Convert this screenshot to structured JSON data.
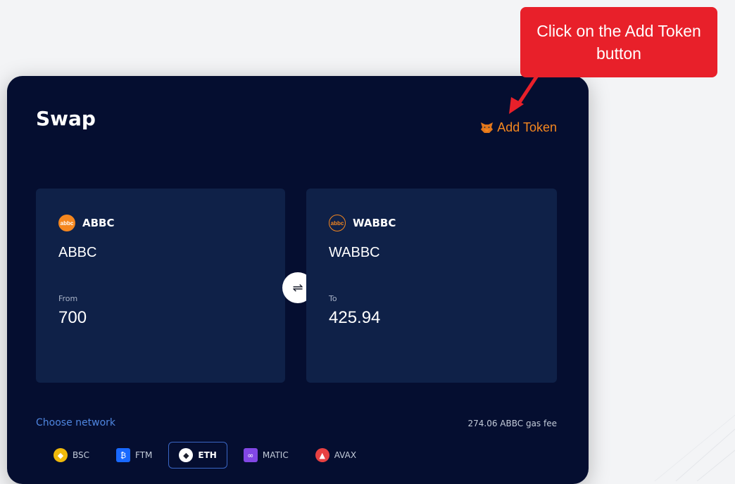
{
  "callout": {
    "text": "Click on the Add Token button"
  },
  "swap": {
    "title": "Swap",
    "add_token_label": "Add Token",
    "from": {
      "symbol": "ABBC",
      "name": "ABBC",
      "label": "From",
      "amount": "700",
      "logo_text": "abbc"
    },
    "to": {
      "symbol": "WABBC",
      "name": "WABBC",
      "label": "To",
      "amount": "425.94",
      "logo_text": "abbc"
    },
    "swap_icon": "⇌",
    "choose_network_label": "Choose network",
    "gas_fee": "274.06 ABBC gas fee",
    "networks": [
      {
        "label": "BSC",
        "icon": "bsc-icon",
        "glyph": "◆"
      },
      {
        "label": "FTM",
        "icon": "ftm-icon",
        "glyph": "₿"
      },
      {
        "label": "ETH",
        "icon": "eth-icon",
        "glyph": "◆"
      },
      {
        "label": "MATIC",
        "icon": "matic-icon",
        "glyph": "∞"
      },
      {
        "label": "AVAX",
        "icon": "avax-icon",
        "glyph": "▲"
      }
    ],
    "selected_network": "ETH"
  },
  "colors": {
    "card_bg": "#050e30",
    "panel_bg": "#0f2148",
    "accent_orange": "#f5871f",
    "link_blue": "#4f86e0",
    "callout_red": "#e8202a"
  }
}
